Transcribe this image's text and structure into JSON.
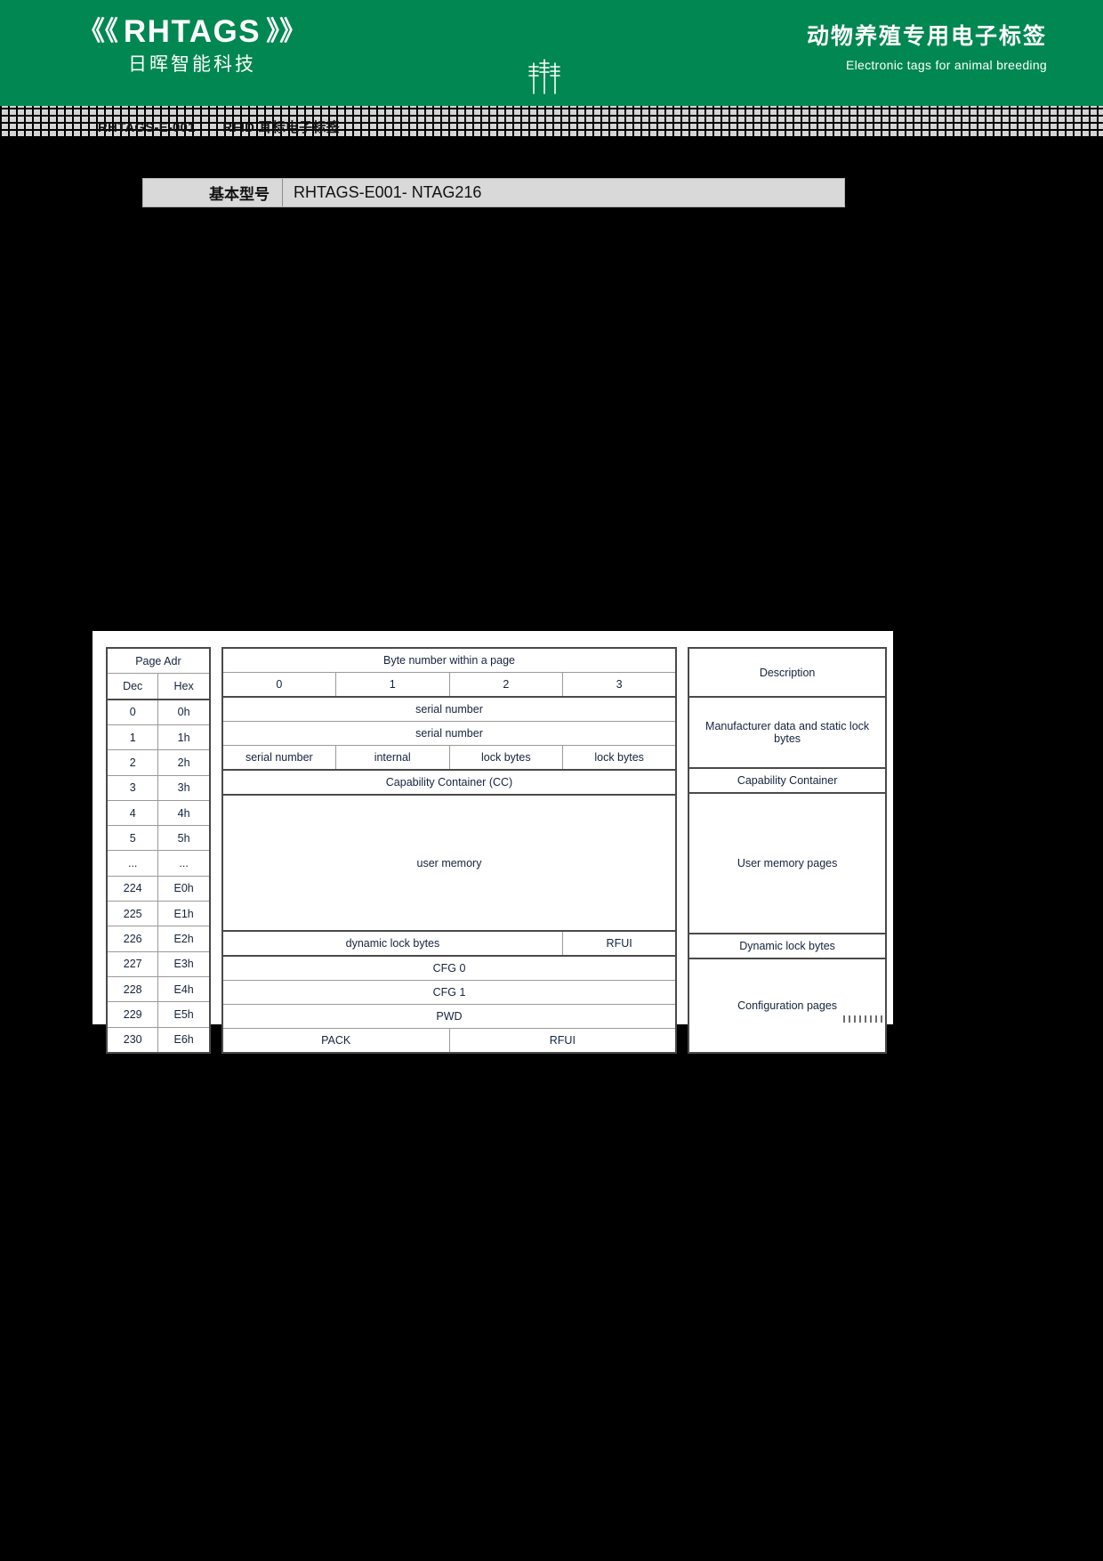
{
  "header": {
    "brand_name": "RHTAGS",
    "brand_wave_left": "《《",
    "brand_wave_right": "》》",
    "brand_cn": "日晖智能科技",
    "tagline_cn": "动物养殖专用电子标签",
    "tagline_en": "Electronic tags for animal breeding",
    "background_color": "#018751",
    "wheat_icon": "wheat-icon"
  },
  "section_band": {
    "title_code": "RHTAGS-E-001",
    "title_text": "RFID 耳标电子标签"
  },
  "model": {
    "label": "基本型号",
    "value": "RHTAGS-E001- NTAG216"
  },
  "memory_table": {
    "page_adr_header": "Page Adr",
    "dec_header": "Dec",
    "hex_header": "Hex",
    "byte_header": "Byte number within a page",
    "byte_cols": [
      "0",
      "1",
      "2",
      "3"
    ],
    "description_header": "Description",
    "rows": [
      {
        "dec": "0",
        "hex": "0h"
      },
      {
        "dec": "1",
        "hex": "1h"
      },
      {
        "dec": "2",
        "hex": "2h"
      },
      {
        "dec": "3",
        "hex": "3h"
      },
      {
        "dec": "4",
        "hex": "4h"
      },
      {
        "dec": "5",
        "hex": "5h"
      },
      {
        "dec": "...",
        "hex": "..."
      },
      {
        "dec": "224",
        "hex": "E0h"
      },
      {
        "dec": "225",
        "hex": "E1h"
      },
      {
        "dec": "226",
        "hex": "E2h"
      },
      {
        "dec": "227",
        "hex": "E3h"
      },
      {
        "dec": "228",
        "hex": "E4h"
      },
      {
        "dec": "229",
        "hex": "E5h"
      },
      {
        "dec": "230",
        "hex": "E6h"
      }
    ],
    "content": {
      "serial_number_0": "serial number",
      "serial_number_1": "serial number",
      "serial_number_2": "serial number",
      "internal": "internal",
      "lock_bytes_a": "lock bytes",
      "lock_bytes_b": "lock bytes",
      "capability_container": "Capability Container (CC)",
      "user_memory": "user memory",
      "dynamic_lock_bytes": "dynamic lock bytes",
      "rfui_dynamic": "RFUI",
      "cfg0": "CFG 0",
      "cfg1": "CFG 1",
      "pwd": "PWD",
      "pack": "PACK",
      "rfui_pack": "RFUI"
    },
    "descriptions": {
      "manufacturer": "Manufacturer data and static lock bytes",
      "manufacturer_line1": "Manufacturer data and",
      "manufacturer_line2": "static lock bytes",
      "capability_container": "Capability Container",
      "user_memory_pages": "User memory pages",
      "dynamic_lock_bytes": "Dynamic lock bytes",
      "configuration_pages": "Configuration pages"
    }
  }
}
